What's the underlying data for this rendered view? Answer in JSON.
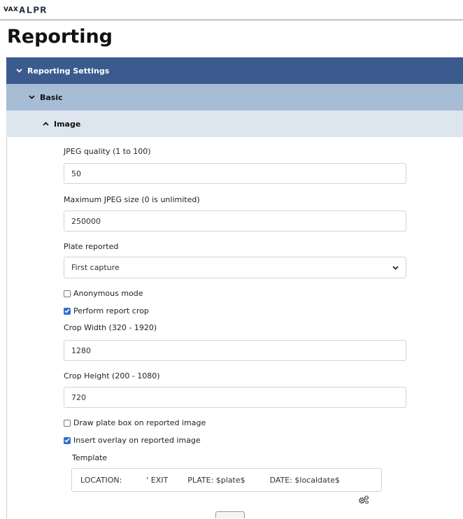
{
  "brand": {
    "prefix": "VAX",
    "name": "ALPR"
  },
  "page": {
    "title": "Reporting"
  },
  "sections": {
    "reporting_settings": "Reporting Settings",
    "basic": "Basic",
    "image": "Image"
  },
  "fields": {
    "jpeg_quality": {
      "label": "JPEG quality (1 to 100)",
      "value": "50"
    },
    "max_jpeg_size": {
      "label": "Maximum JPEG size (0 is unlimited)",
      "value": "250000"
    },
    "plate_reported": {
      "label": "Plate reported",
      "value": "First capture"
    },
    "anonymous_mode": {
      "label": "Anonymous mode",
      "checked": false
    },
    "perform_report_crop": {
      "label": "Perform report crop",
      "checked": true
    },
    "crop_width": {
      "label": "Crop Width (320 - 1920)",
      "value": "1280"
    },
    "crop_height": {
      "label": "Crop Height (200 - 1080)",
      "value": "720"
    },
    "draw_plate_box": {
      "label": "Draw plate box on reported image",
      "checked": false
    },
    "insert_overlay": {
      "label": "Insert overlay on reported image",
      "checked": true
    },
    "template": {
      "label": "Template",
      "value": "LOCATION:          ' EXIT        PLATE: $plate$          DATE: $localdate$"
    }
  },
  "icons": {
    "chevron": "chevron-icon",
    "settings": "gears-icon"
  },
  "colors": {
    "header_dark": "#3b5b8f",
    "header_mid": "#a7bdd6",
    "header_light": "#dde5ef",
    "checkbox_on": "#2f6fd6"
  }
}
